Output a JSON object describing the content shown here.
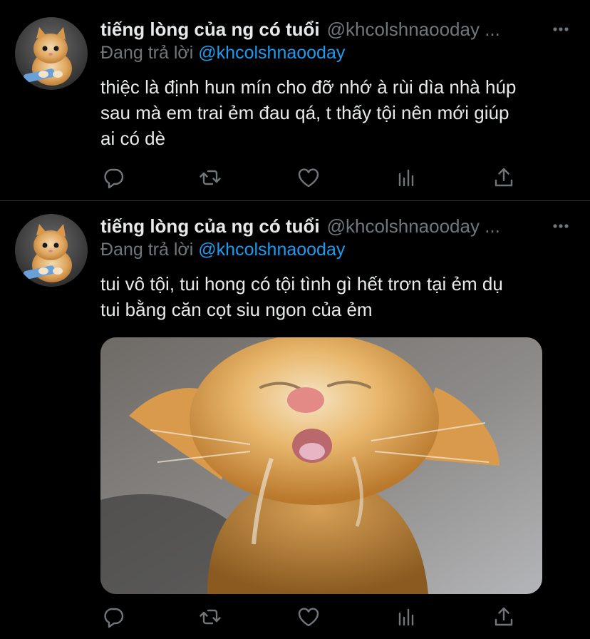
{
  "colors": {
    "background": "#000000",
    "primary_text": "#e7e9ea",
    "secondary_text": "#71767b",
    "link": "#1d9bf0",
    "divider": "#2f3336"
  },
  "icons": {
    "more": "more-horizontal-icon",
    "reply": "comment-bubble-icon",
    "retweet": "retweet-arrows-icon",
    "like": "heart-outline-icon",
    "views": "bar-chart-icon",
    "share": "upload-share-icon"
  },
  "tweets": [
    {
      "display_name": "tiếng lòng của ng có tuổi",
      "handle": "@khcolshnaooday ...",
      "reply_prefix": "Đang trả lời",
      "reply_to": "@khcolshnaooday",
      "text": "thiệc là định hun mín cho đỡ nhớ à rùi dìa nhà húp\nsau mà em trai ẻm đau qá, t thấy tội nên mới giúp\nai có dè"
    },
    {
      "display_name": "tiếng lòng của ng có tuổi",
      "handle": "@khcolshnaooday ...",
      "reply_prefix": "Đang trả lời",
      "reply_to": "@khcolshnaooday",
      "text": "tui vô tội, tui hong có tội tình gì hết trơn tại ẻm dụ\ntui bằng căn cọt siu ngon của ẻm",
      "media": "crying-kitten-photo"
    }
  ]
}
